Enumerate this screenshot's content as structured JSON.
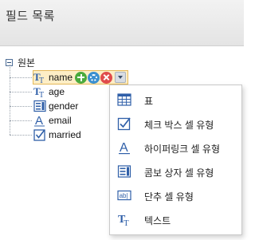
{
  "header": {
    "title": "필드 목록"
  },
  "tree": {
    "root": {
      "label": "원본",
      "expanded": true
    },
    "fields": [
      {
        "label": "name",
        "icon": "text-field-icon",
        "selected": true
      },
      {
        "label": "age",
        "icon": "text-field-icon",
        "selected": false
      },
      {
        "label": "gender",
        "icon": "combobox-field-icon",
        "selected": false
      },
      {
        "label": "email",
        "icon": "hyperlink-field-icon",
        "selected": false
      },
      {
        "label": "married",
        "icon": "checkbox-field-icon",
        "selected": false
      }
    ],
    "row_actions": [
      "add-icon",
      "settings-icon",
      "delete-icon",
      "dropdown-arrow-icon"
    ]
  },
  "context_menu": {
    "items": [
      {
        "label": "표",
        "icon": "table-icon"
      },
      {
        "label": "체크 박스 셀 유형",
        "icon": "checkbox-icon"
      },
      {
        "label": "하이퍼링크 셀 유형",
        "icon": "hyperlink-icon"
      },
      {
        "label": "콤보 상자 셀 유형",
        "icon": "combobox-icon"
      },
      {
        "label": "단추 셀 유형",
        "icon": "button-icon"
      },
      {
        "label": "텍스트",
        "icon": "text-icon"
      }
    ]
  },
  "colors": {
    "selection_bg": "#fdeec6",
    "selection_border": "#e5b95a",
    "add": "#4aaa3d",
    "settings": "#3a8fd0",
    "delete": "#e04b4b",
    "icon_blue": "#2f5fa8"
  }
}
